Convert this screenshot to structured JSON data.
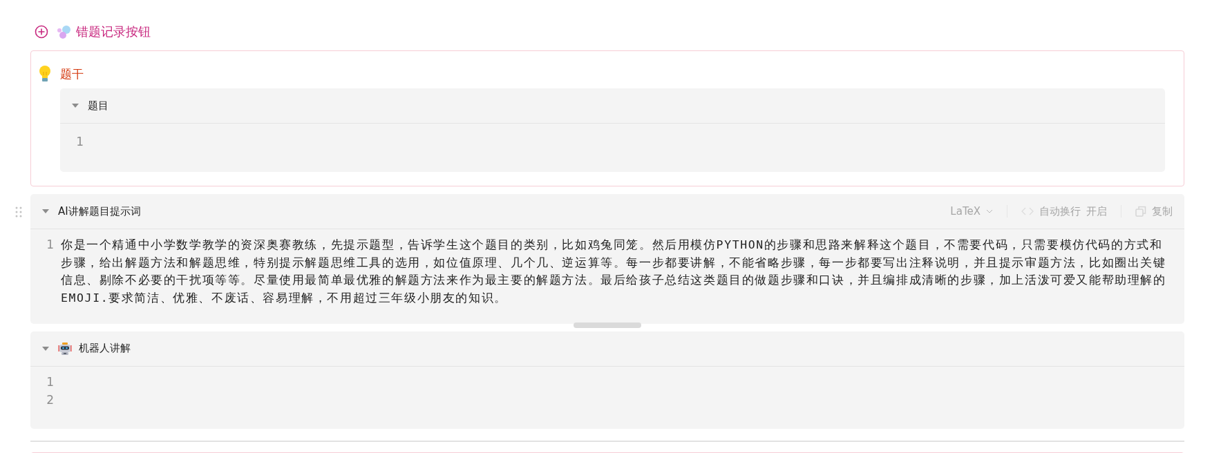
{
  "add_block": {
    "title": "错题记录按钮"
  },
  "callout": {
    "title": "题干",
    "block": {
      "title": "题目",
      "expanded": true,
      "has_icon": false,
      "lines": [
        {
          "number": "1"
        }
      ]
    }
  },
  "blocks": [
    {
      "title": "AI讲解题目提示词",
      "expanded": true,
      "has_icon": false,
      "toolbar": {
        "language": "LaTeX",
        "wrap_label": "自动换行",
        "wrap_state": "开启",
        "copy": "复制"
      },
      "lines": [
        {
          "number": "1",
          "text": "你是一个精通中小学数学教学的资深奥赛教练，先提示题型，告诉学生这个题目的类别，比如鸡兔同笼。然后用模仿PYTHON的步骤和思路来解释这个题目，不需要代码，只需要模仿代码的方式和步骤，给出解题方法和解题思维，特别提示解题思维工具的选用，如位值原理、几个几、逆运算等。每一步都要讲解，不能省略步骤，每一步都要写出注释说明，并且提示审题方法，比如圈出关键信息、剔除不必要的干扰项等等。尽量使用最简单最优雅的解题方法来作为最主要的解题方法。最后给孩子总结这类题目的做题步骤和口诀，并且编排成清晰的步骤，加上活泼可爱又能帮助理解的EMOJI.要求简洁、优雅、不废话、容易理解，不用超过三年级小朋友的知识。"
        }
      ]
    },
    {
      "title": "机器人讲解",
      "expanded": true,
      "has_icon": true,
      "lines": [
        {
          "number": "1"
        },
        {
          "number": "2"
        }
      ]
    }
  ]
}
